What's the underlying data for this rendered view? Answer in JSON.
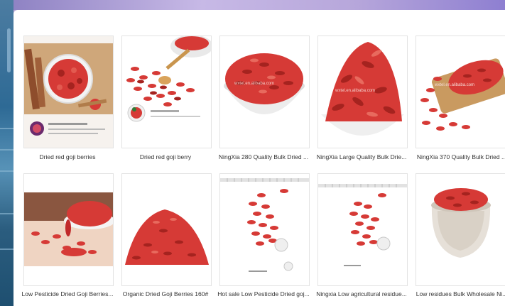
{
  "results": [
    {
      "caption": "Dried red goji berries",
      "image_label": "goji berries in bowl with sticks",
      "watermark": ""
    },
    {
      "caption": "Dried red goji berry",
      "image_label": "goji berries with wooden spoon",
      "watermark": ""
    },
    {
      "caption": "NingXia 280 Quality Bulk Dried ...",
      "image_label": "bowl of goji berries",
      "watermark": "wxtel.en.alibaba.com"
    },
    {
      "caption": "NingXia Large Quality Bulk Drie...",
      "image_label": "heap of large goji berries",
      "watermark": "wxtel.en.alibaba.com"
    },
    {
      "caption": "NingXia 370 Quality Bulk Dried ...",
      "image_label": "goji berries on board",
      "watermark": "wxtel.en.alibaba.com"
    },
    {
      "caption": "Low Pesticide Dried Goji Berries...",
      "image_label": "goji berries with white bowl",
      "watermark": ""
    },
    {
      "caption": "Organic Dried Goji Berries 160#",
      "image_label": "pile of goji berries",
      "watermark": ""
    },
    {
      "caption": "Hot sale Low Pesticide Dried goj...",
      "image_label": "goji berries with coin and ruler",
      "watermark": ""
    },
    {
      "caption": "Ningxia Low agricultural residue...",
      "image_label": "goji berries with coin and ruler",
      "watermark": ""
    },
    {
      "caption": "Low residues Bulk Wholesale Ni...",
      "image_label": "goji berries in stone bowl",
      "watermark": ""
    }
  ],
  "colors": {
    "berry": "#d63a36",
    "berry_dark": "#a5231f",
    "background": "#ffffff",
    "frame": "#b9a8d6"
  }
}
